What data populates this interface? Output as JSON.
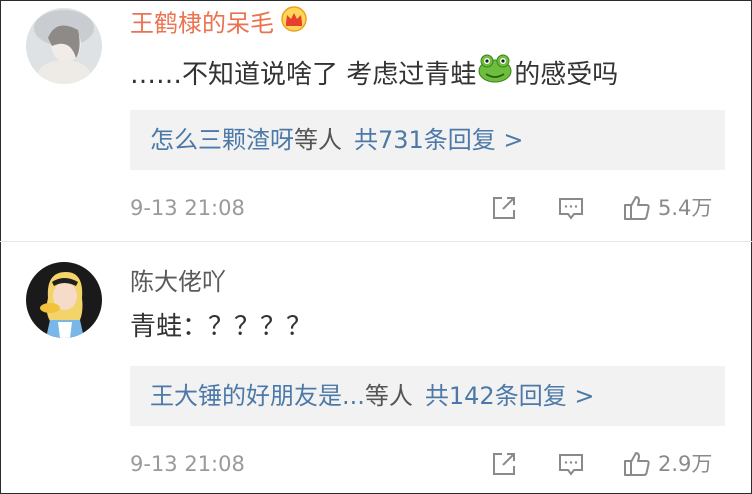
{
  "comments": [
    {
      "username": "王鹤棣的呆毛",
      "username_color": "#eb7350",
      "badge_icon": "crown-icon",
      "text_before_emoji": "……不知道说啥了  考虑过青蛙",
      "emoji": "frog-emoji",
      "text_after_emoji": "的感受吗",
      "replies": {
        "names": "怎么三颗渣呀",
        "suffix": "等人",
        "count_label": "共731条回复 >"
      },
      "timestamp": "9-13 21:08",
      "like_count": "5.4万"
    },
    {
      "username": "陈大佬吖",
      "username_color": "#5a5a5a",
      "text": "青蛙：？？？？",
      "replies": {
        "names": "王大锤的好朋友是...",
        "suffix": "等人",
        "count_label": "共142条回复 >"
      },
      "timestamp": "9-13 21:08",
      "like_count": "2.9万"
    }
  ],
  "icons": {
    "share": "share-icon",
    "comment": "comment-icon",
    "like": "thumbs-up-icon"
  },
  "colors": {
    "link_blue": "#4d79a8",
    "vip_orange": "#eb7350",
    "reply_bg": "#f2f2f2",
    "meta_gray": "#9a9a9a"
  }
}
